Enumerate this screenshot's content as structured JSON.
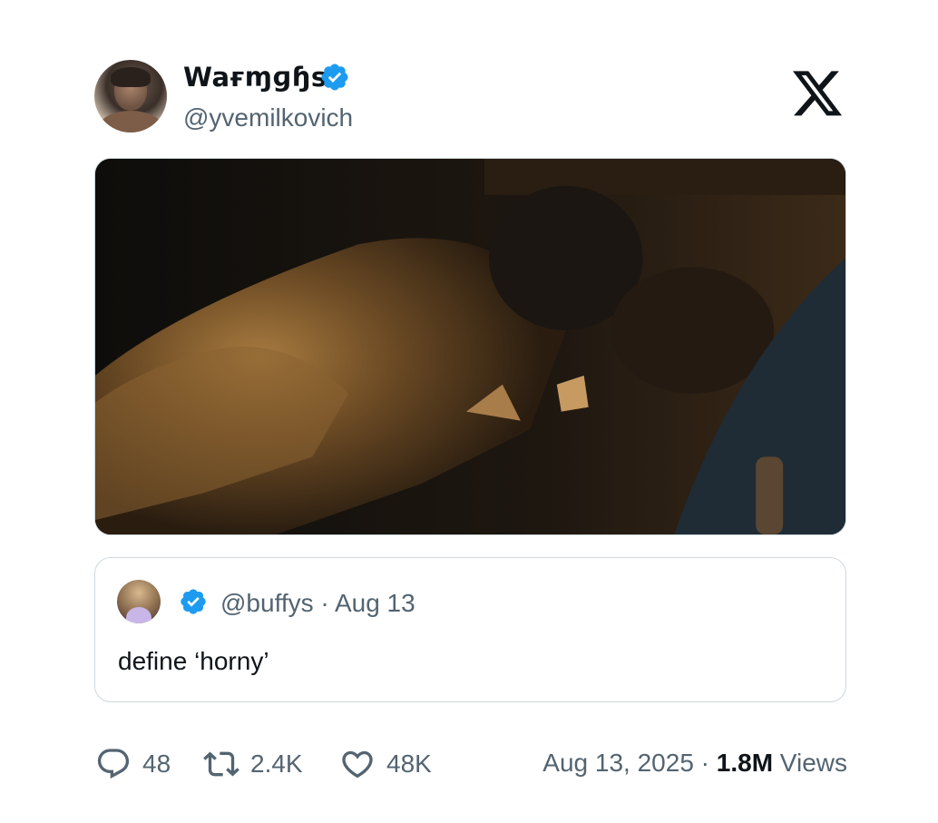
{
  "author": {
    "display_name": "Waғɱɡɧs",
    "handle": "@yvemilkovich",
    "verified": true
  },
  "brand": {
    "logo": "x-logo-icon"
  },
  "quoted_post": {
    "handle": "@buffys",
    "separator": "·",
    "date": "Aug 13",
    "meta": "@buffys · Aug 13",
    "text": "define ‘horny’",
    "verified": true
  },
  "stats": {
    "replies": "48",
    "reposts": "2.4K",
    "likes": "48K"
  },
  "footer": {
    "date": "Aug 13, 2025 · ",
    "views_count": "1.8M",
    "views_label": " Views"
  },
  "colors": {
    "verified_blue": "#1d9bf0",
    "muted_text": "#536471",
    "border": "#cfd9de"
  }
}
